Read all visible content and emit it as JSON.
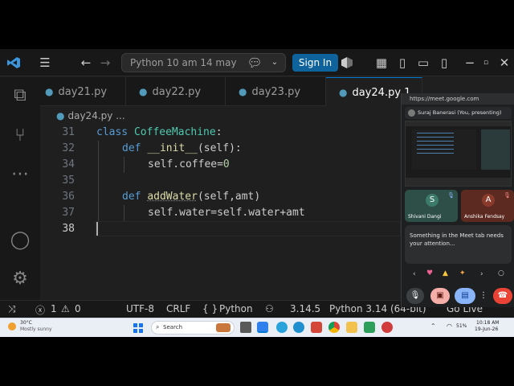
{
  "titlebar": {
    "search_text": "Python 10 am 14 may",
    "sign_in_label": "Sign In"
  },
  "tabs": [
    {
      "label": "day21.py"
    },
    {
      "label": "day22.py"
    },
    {
      "label": "day23.py"
    },
    {
      "label": "day24.py 1"
    }
  ],
  "breadcrumb": "day24.py",
  "breadcrumb_more": "...",
  "code_lines": [
    {
      "num": "31"
    },
    {
      "num": "32"
    },
    {
      "num": "34"
    },
    {
      "num": "35"
    },
    {
      "num": "36"
    },
    {
      "num": "37"
    },
    {
      "num": "38"
    }
  ],
  "code": {
    "l31_kw": "class",
    "l31_name": "CoffeeMachine",
    "l31_end": ":",
    "l32_kw": "def",
    "l32_name": "__init__",
    "l32_end": "(self):",
    "l34_a": "self.coffee=",
    "l34_b": "0",
    "l36_kw": "def",
    "l36_name": "addWater",
    "l36_end": "(self,amt)",
    "l37": "self.water=self.water+amt"
  },
  "statusbar": {
    "errors": "1",
    "warnings": "0",
    "encoding": "UTF-8",
    "eol": "CRLF",
    "language": "Python",
    "braces": "{ }",
    "version": "3.14.5",
    "interpreter": "Python 3.14 (64-bit)",
    "go_live": "Go Live"
  },
  "meet": {
    "url": "https://meet.google.com",
    "presenter": "Suraj Banerasi (You, presenting)",
    "tiles": [
      {
        "initial": "S",
        "name": "Shivani Dangi",
        "color": "#3c7a6a"
      },
      {
        "initial": "A",
        "name": "Anshika Fendsay",
        "color": "#8a3a2a"
      }
    ],
    "notice": "Something in the Meet tab needs your attention..."
  },
  "taskbar": {
    "weather_temp": "30°C",
    "weather_desc": "Mostly sunny",
    "search_placeholder": "Search",
    "time": "10:18 AM",
    "date": "19-Jun-26",
    "battery": "51%"
  },
  "colors": {
    "accent": "#0078d4",
    "keyword": "#569cd6",
    "class_name": "#4ec9b0",
    "function": "#dcdcaa",
    "number": "#b5cea8",
    "sign_in_bg": "#0e639c",
    "end_call": "#ea4335"
  }
}
